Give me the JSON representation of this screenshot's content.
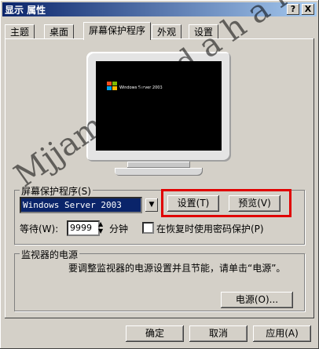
{
  "window": {
    "title": "显示 属性",
    "help_glyph": "?",
    "close_glyph": "X"
  },
  "tabs": [
    "主题",
    "桌面",
    "屏幕保护程序",
    "外观",
    "设置"
  ],
  "screensaver": {
    "group_label": "屏幕保护程序(S)",
    "selected": "Windows Server 2003",
    "settings_button": "设置(T)",
    "preview_button": "预览(V)",
    "wait_label": "等待(W):",
    "wait_value": "9999",
    "minutes_label": "分钟",
    "password_label": "在恢复时使用密码保护(P)"
  },
  "preview": {
    "brand_line": "Windows Server 2003"
  },
  "power": {
    "group_label": "监视器的电源",
    "description": "要调整监视器的电源设置并且节能，请单击“电源”。",
    "button": "电源(O)..."
  },
  "footer": {
    "ok": "确定",
    "cancel": "取消",
    "apply": "应用(A)"
  },
  "watermark": {
    "text": "Mjjame i i s d a h a i"
  }
}
